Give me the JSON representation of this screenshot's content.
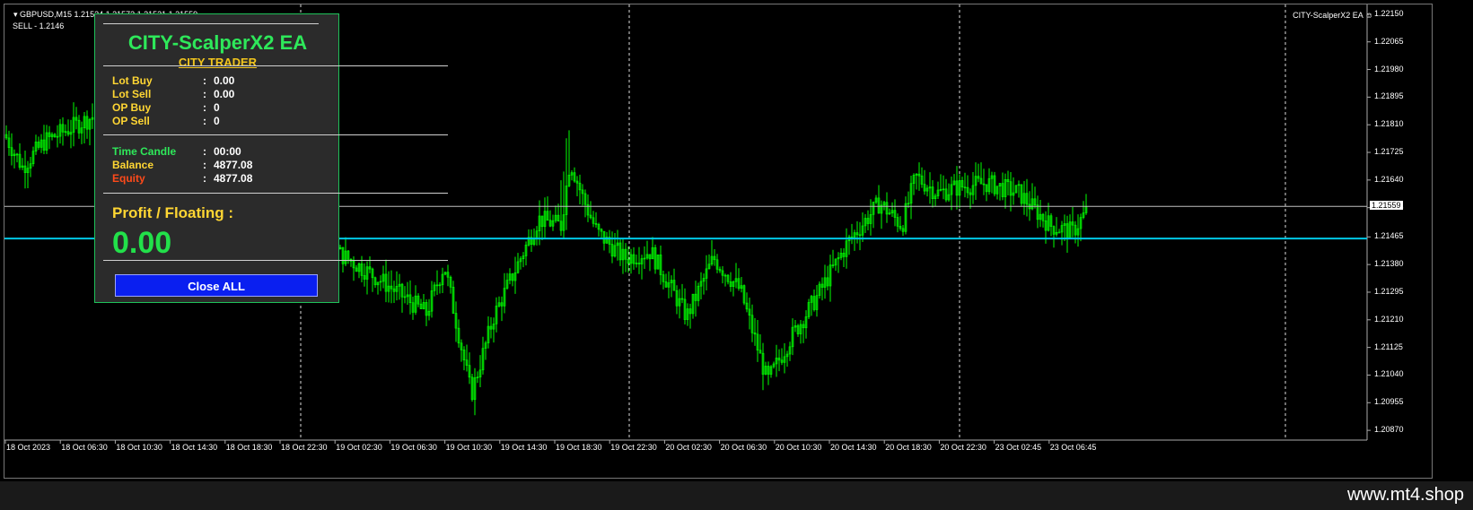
{
  "chart": {
    "symbol_info": "GBPUSD,M15  1.21524 1.21573 1.21521 1.21559",
    "sell_info": "SELL - 1.2146",
    "ea_name": "CITY-ScalperX2 EA ☺",
    "current_price": "1.21559",
    "price_axis": [
      "1.22150",
      "1.22065",
      "1.21980",
      "1.21895",
      "1.21810",
      "1.21725",
      "1.21640",
      "1.21555",
      "1.21465",
      "1.21380",
      "1.21295",
      "1.21210",
      "1.21125",
      "1.21040",
      "1.20955",
      "1.20870"
    ],
    "time_axis": [
      "18 Oct 2023",
      "18 Oct 06:30",
      "18 Oct 10:30",
      "18 Oct 14:30",
      "18 Oct 18:30",
      "18 Oct 22:30",
      "19 Oct 02:30",
      "19 Oct 06:30",
      "19 Oct 10:30",
      "19 Oct 14:30",
      "19 Oct 18:30",
      "19 Oct 22:30",
      "20 Oct 02:30",
      "20 Oct 06:30",
      "20 Oct 10:30",
      "20 Oct 14:30",
      "20 Oct 18:30",
      "20 Oct 22:30",
      "23 Oct 02:45",
      "23 Oct 06:45"
    ],
    "colors": {
      "candle": "#00ff00",
      "sell_line": "#00c8e6",
      "bid_line": "#c0c0c0",
      "grid": "#ffffff"
    },
    "sell_level": 1.2146,
    "bid_level": 1.21559
  },
  "panel": {
    "title": "CITY-ScalperX2 EA",
    "subtitle": "CITY TRADER",
    "rows": [
      {
        "label": "Lot Buy",
        "value": "0.00",
        "color": "#ffd633"
      },
      {
        "label": "Lot Sell",
        "value": "0.00",
        "color": "#ffd633"
      },
      {
        "label": "OP Buy",
        "value": "0",
        "color": "#ffd633"
      },
      {
        "label": "OP Sell",
        "value": "0",
        "color": "#ffd633"
      },
      {
        "label": "Time Candle",
        "value": "00:00",
        "color": "#2ee85a"
      },
      {
        "label": "Balance",
        "value": "4877.08",
        "color": "#ffd633"
      },
      {
        "label": "Equity",
        "value": "4877.08",
        "color": "#ff4a1a"
      }
    ],
    "colon": ":",
    "profit_label": "Profit / Floating  :",
    "profit_value": "0.00",
    "close_button": "Close ALL"
  },
  "footer": {
    "watermark": "www.mt4.shop"
  }
}
